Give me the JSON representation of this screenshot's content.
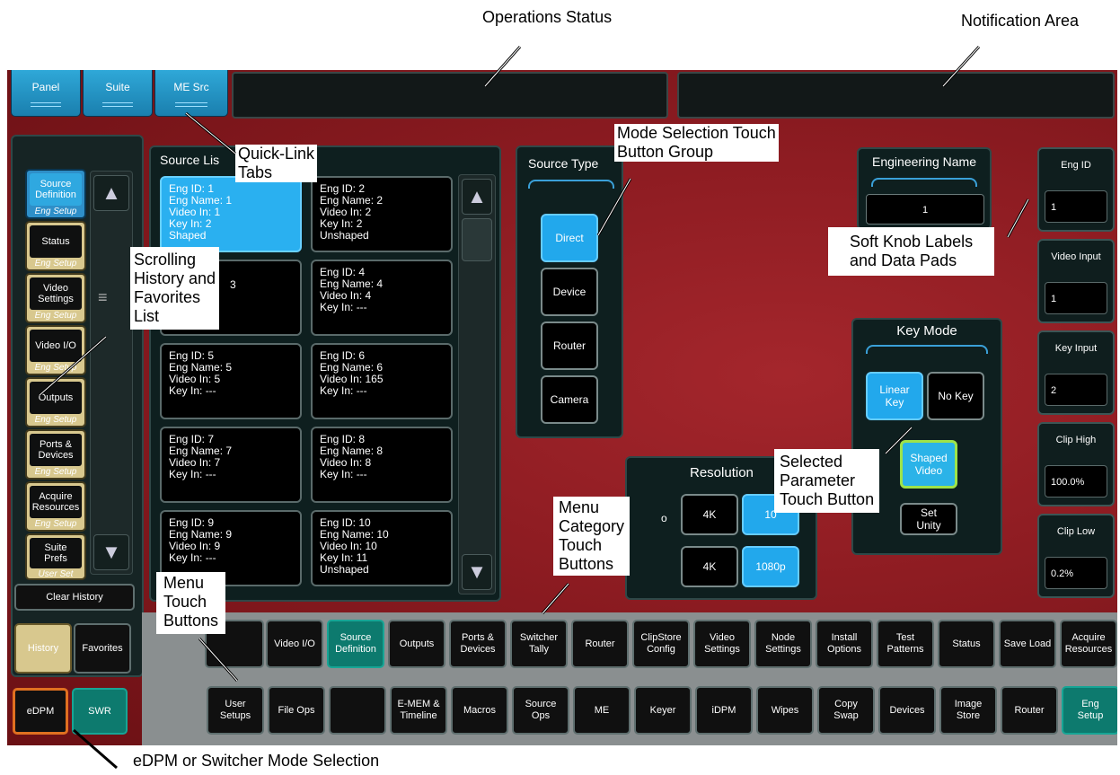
{
  "annotations": {
    "operations_status": "Operations Status",
    "notification_area": "Notification Area",
    "quick_link_tabs": "Quick-Link\nTabs",
    "mode_selection": "Mode Selection Touch\nButton Group",
    "soft_knob": "Soft Knob Labels\nand Data Pads",
    "scrolling_history": "Scrolling\nHistory and\nFavorites\nList",
    "selected_parameter": "Selected\nParameter\nTouch Button",
    "menu_category": "Menu\nCategory\nTouch\nButtons",
    "menu_touch": "Menu\nTouch\nButtons",
    "edpm_mode": "eDPM or Switcher Mode Selection"
  },
  "quick_tabs": [
    "Panel",
    "Suite",
    "ME Src"
  ],
  "history": [
    {
      "title": "Source\nDefinition",
      "sub": "Eng Setup",
      "selected": true
    },
    {
      "title": "Status",
      "sub": "Eng Setup"
    },
    {
      "title": "Video\nSettings",
      "sub": "Eng Setup"
    },
    {
      "title": "Video I/O",
      "sub": "Eng Setup"
    },
    {
      "title": "Outputs",
      "sub": "Eng Setup"
    },
    {
      "title": "Ports &\nDevices",
      "sub": "Eng Setup"
    },
    {
      "title": "Acquire\nResources",
      "sub": "Eng Setup"
    },
    {
      "title": "Suite\nPrefs",
      "sub": "User Set"
    }
  ],
  "clear_history": "Clear History",
  "history_tab": "History",
  "favorites_tab": "Favorites",
  "mode_edpm": "eDPM",
  "mode_swr": "SWR",
  "source_list_title": "Source Lis",
  "sources": [
    "Eng ID: 1\nEng Name: 1\nVideo In: 1\nKey In: 2\nShaped",
    "Eng ID: 2\nEng Name: 2\nVideo In: 2\nKey In: 2\nUnshaped",
    "3",
    "Eng ID: 4\nEng Name: 4\nVideo In: 4\nKey In: ---",
    "Eng ID: 5\nEng Name: 5\nVideo In: 5\nKey In: ---",
    "Eng ID: 6\nEng Name: 6\nVideo In: 165\nKey In: ---",
    "Eng ID: 7\nEng Name: 7\nVideo In: 7\nKey In: ---",
    "Eng ID: 8\nEng Name: 8\nVideo In: 8\nKey In: ---",
    "Eng ID: 9\nEng Name: 9\nVideo In: 9\nKey In: ---",
    "Eng ID: 10\nEng Name: 10\nVideo In: 10\nKey In: 11\nUnshaped"
  ],
  "source_type_title": "Source Type",
  "source_types": [
    "Direct",
    "Device",
    "Router",
    "Camera"
  ],
  "engineering_name_title": "Engineering Name",
  "engineering_name_value": "1",
  "key_mode_title": "Key Mode",
  "key_linear": "Linear\nKey",
  "key_none": "No Key",
  "key_shaped": "Shaped\nVideo",
  "key_unity": "Set\nUnity",
  "resolution_title": "Resolution",
  "res_frag": "o",
  "res_row1": [
    "4K",
    "10"
  ],
  "res_row2": [
    "4K",
    "1080p"
  ],
  "soft_knobs": [
    {
      "label": "Eng ID",
      "value": "1"
    },
    {
      "label": "Video Input",
      "value": "1"
    },
    {
      "label": "Key Input",
      "value": "2"
    },
    {
      "label": "Clip High",
      "value": "100.0%"
    },
    {
      "label": "Clip Low",
      "value": "0.2%"
    }
  ],
  "menu_row1": [
    "",
    "Video I/O",
    "Source\nDefinition",
    "Outputs",
    "Ports &\nDevices",
    "Switcher\nTally",
    "Router",
    "ClipStore\nConfig",
    "Video\nSettings",
    "Node\nSettings",
    "Install\nOptions",
    "Test\nPatterns",
    "Status",
    "Save Load",
    "Acquire\nResources"
  ],
  "menu_row2": [
    "User\nSetups",
    "File Ops",
    "",
    "E-MEM &\nTimeline",
    "Macros",
    "Source\nOps",
    "ME",
    "Keyer",
    "iDPM",
    "Wipes",
    "Copy\nSwap",
    "Devices",
    "Image\nStore",
    "Router",
    "Eng\nSetup"
  ],
  "colors": {
    "background": "#8e1c22",
    "accent_blue": "#2ab0f0",
    "teal": "#0d7a6e",
    "orange": "#e07020"
  }
}
